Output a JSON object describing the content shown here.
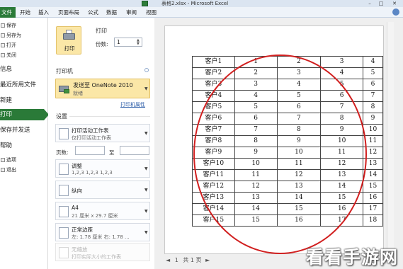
{
  "window": {
    "title": "表格2.xlsx - Microsoft Excel",
    "controls": [
      "–",
      "□",
      "✕"
    ]
  },
  "ribbon": {
    "tabs": [
      "文件",
      "开始",
      "插入",
      "页面布局",
      "公式",
      "数据",
      "审阅",
      "视图"
    ]
  },
  "nav": {
    "items": [
      {
        "label": "保存",
        "icon": "save-icon"
      },
      {
        "label": "另存为",
        "icon": "save-as-icon"
      },
      {
        "label": "打开",
        "icon": "open-folder-icon"
      },
      {
        "label": "关闭",
        "icon": "close-file-icon"
      },
      {
        "label": "信息"
      },
      {
        "label": "最近所用文件"
      },
      {
        "label": "新建"
      },
      {
        "label": "打印"
      },
      {
        "label": "保存并发送"
      },
      {
        "label": "帮助"
      },
      {
        "label": "选项",
        "icon": "options-icon"
      },
      {
        "label": "退出",
        "icon": "exit-icon"
      }
    ],
    "selected": "打印"
  },
  "print": {
    "heading": "打印",
    "button_label": "打印",
    "copies_label": "份数:",
    "copies_value": "1"
  },
  "printer": {
    "heading": "打印机",
    "name": "发送至 OneNote 2010",
    "status": "就绪",
    "properties_link": "打印机属性"
  },
  "settings": {
    "heading": "设置",
    "print_what": {
      "main": "打印活动工作表",
      "sub": "仅打印活动工作表"
    },
    "pages_label": "页数:",
    "pages_to": "至",
    "collate": {
      "main": "调整",
      "sub": "1,2,3    1,2,3    1,2,3"
    },
    "orientation": {
      "main": "纵向"
    },
    "paper": {
      "main": "A4",
      "sub": "21 厘米 x 29.7 厘米"
    },
    "margins": {
      "main": "正常边距",
      "sub": "左: 1.78 厘米    右: 1.78 ..."
    },
    "scaling": {
      "main": "无缩放",
      "sub": "打印实际大小的工作表"
    }
  },
  "preview": {
    "rows": [
      [
        "客户1",
        "1",
        "2",
        "3",
        "4"
      ],
      [
        "客户2",
        "2",
        "3",
        "4",
        "5"
      ],
      [
        "客户3",
        "3",
        "4",
        "5",
        "6"
      ],
      [
        "客户4",
        "4",
        "5",
        "6",
        "7"
      ],
      [
        "客户5",
        "5",
        "6",
        "7",
        "8"
      ],
      [
        "客户6",
        "6",
        "7",
        "8",
        "9"
      ],
      [
        "客户7",
        "7",
        "8",
        "9",
        "10"
      ],
      [
        "客户8",
        "8",
        "9",
        "10",
        "11"
      ],
      [
        "客户9",
        "9",
        "10",
        "11",
        "12"
      ],
      [
        "客户10",
        "10",
        "11",
        "12",
        "13"
      ],
      [
        "客户11",
        "11",
        "12",
        "13",
        "14"
      ],
      [
        "客户12",
        "12",
        "13",
        "14",
        "15"
      ],
      [
        "客户13",
        "13",
        "14",
        "15",
        "16"
      ],
      [
        "客户14",
        "14",
        "15",
        "16",
        "17"
      ],
      [
        "客户15",
        "15",
        "16",
        "17",
        "18"
      ]
    ],
    "page_number": "1",
    "page_total": "共 1 页"
  },
  "watermark": "看看手游网"
}
